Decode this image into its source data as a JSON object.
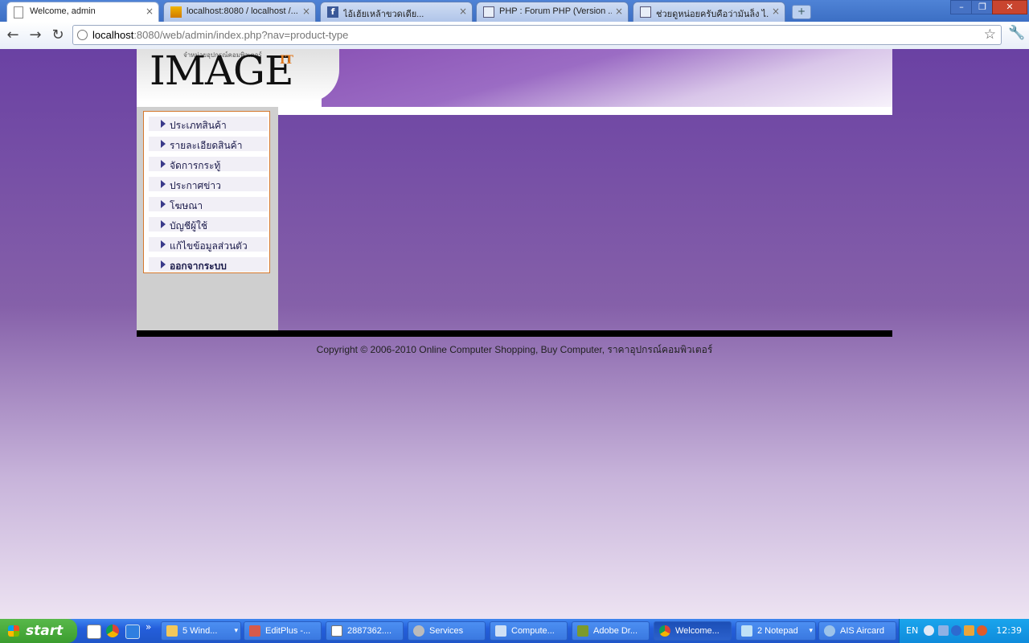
{
  "browser": {
    "tabs": [
      {
        "title": "Welcome, admin",
        "icon": "page-icon",
        "active": true
      },
      {
        "title": "localhost:8080 / localhost /...",
        "icon": "phpmyadmin-icon",
        "active": false
      },
      {
        "title": "ไอ้เฮ้ยเหล้าขวดเดีย...",
        "icon": "facebook-icon",
        "active": false
      },
      {
        "title": "PHP : Forum PHP (Version ...",
        "icon": "forum-icon",
        "active": false
      },
      {
        "title": "ช่วยดูหน่อยครับคือว่ามันล็ง ไ...",
        "icon": "forum-icon",
        "active": false
      }
    ],
    "new_tab": "+",
    "close_glyph": "×",
    "url_host": "localhost",
    "url_rest": ":8080/web/admin/index.php?nav=product-type",
    "window_controls": [
      "–",
      "❐",
      "✕"
    ]
  },
  "site": {
    "logo_tagline": "จำหน่ายอุปกรณ์คอมพิวเตอร์",
    "logo_text": "IMAGE",
    "logo_sup": "IT",
    "menu": [
      {
        "label": "ประเภทสินค้า",
        "bold": false
      },
      {
        "label": "รายละเอียดสินค้า",
        "bold": false
      },
      {
        "label": "จัดการกระทู้",
        "bold": false
      },
      {
        "label": "ประกาศข่าว",
        "bold": false
      },
      {
        "label": "โฆษณา",
        "bold": false
      },
      {
        "label": "บัญชีผู้ใช้",
        "bold": false
      },
      {
        "label": "แก้ไขข้อมูลส่วนตัว",
        "bold": false
      },
      {
        "label": "ออกจากระบบ",
        "bold": true
      }
    ],
    "copyright": "Copyright © 2006-2010 Online Computer Shopping, Buy Computer, ราคาอุปกรณ์คอมพิวเตอร์"
  },
  "taskbar": {
    "start": "start",
    "buttons": [
      {
        "label": "5 Wind...",
        "icon": "folder-icon",
        "dropdown": true
      },
      {
        "label": "EditPlus -...",
        "icon": "editplus-icon",
        "dropdown": false
      },
      {
        "label": "2887362....",
        "icon": "paint-icon",
        "dropdown": false
      },
      {
        "label": "Services",
        "icon": "services-icon",
        "dropdown": false
      },
      {
        "label": "Compute...",
        "icon": "computer-management-icon",
        "dropdown": false
      },
      {
        "label": "Adobe Dr...",
        "icon": "dreamweaver-icon",
        "dropdown": false
      },
      {
        "label": "Welcome...",
        "icon": "chrome-icon",
        "dropdown": false,
        "active": true
      },
      {
        "label": "2 Notepad",
        "icon": "notepad-icon",
        "dropdown": true
      },
      {
        "label": "AIS Aircard",
        "icon": "aircard-icon",
        "dropdown": false
      }
    ],
    "language": "EN",
    "clock": "12:39"
  },
  "colors": {
    "page_bg_top": "#6a41a3",
    "page_bg_bottom": "#ede3f2",
    "menu_border": "#d5792e",
    "logo_accent": "#e27a1f"
  }
}
